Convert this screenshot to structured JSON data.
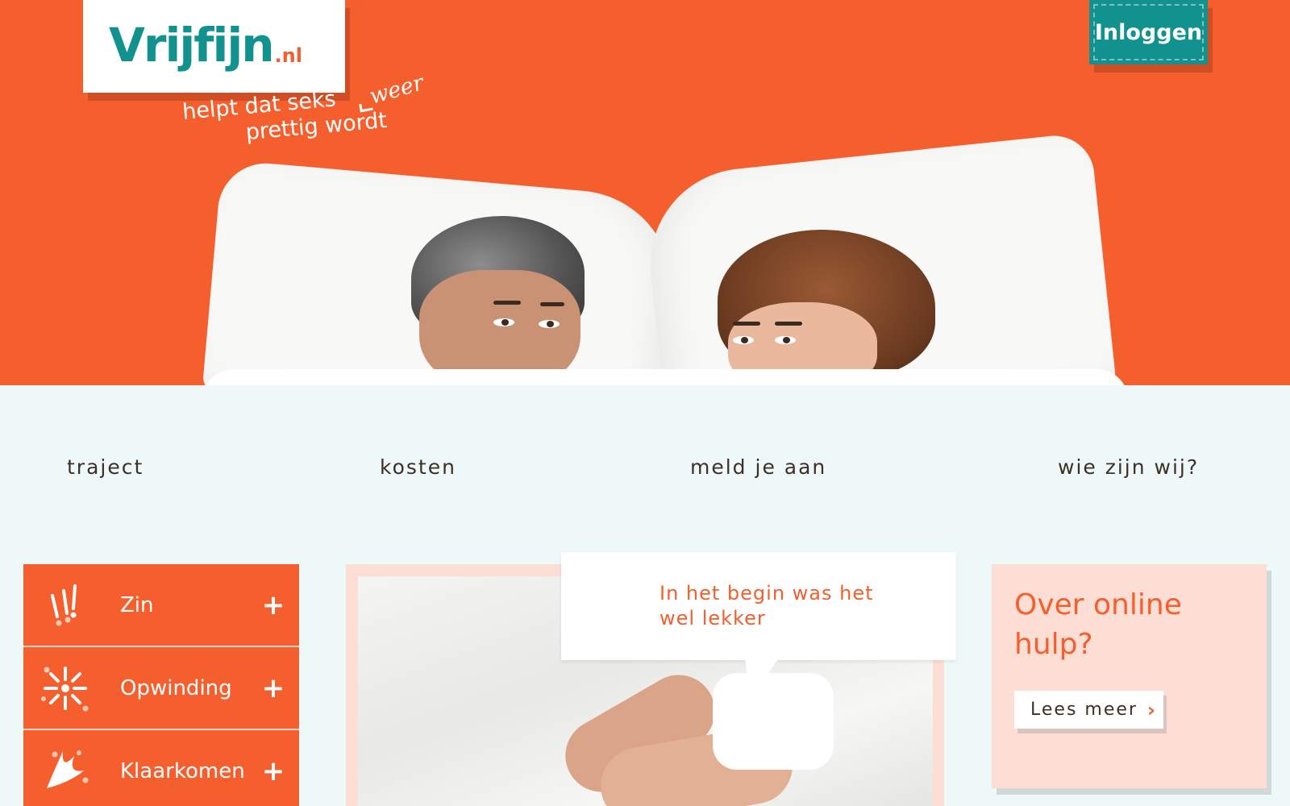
{
  "brand": {
    "name": "Vrijfijn",
    "tld": ".nl",
    "tagline_line1": "helpt dat seks",
    "tagline_line2": "prettig wordt",
    "tagline_insert": "weer",
    "colors": {
      "primary": "#f45f2d",
      "teal": "#12928e",
      "page_bg": "#eef8f8",
      "card_bg": "#fcded4"
    }
  },
  "header": {
    "login_label": "Inloggen"
  },
  "nav": {
    "items": [
      {
        "label": "traject"
      },
      {
        "label": "kosten"
      },
      {
        "label": "meld je aan"
      },
      {
        "label": "wie zijn wij?"
      }
    ]
  },
  "sidebar": {
    "items": [
      {
        "label": "Zin",
        "icon": "exclamation-icon"
      },
      {
        "label": "Opwinding",
        "icon": "sparkle-icon"
      },
      {
        "label": "Klaarkomen",
        "icon": "burst-icon"
      }
    ],
    "expand_symbol": "+"
  },
  "story": {
    "quote": "In het begin was het wel lekker"
  },
  "help": {
    "title": "Over online hulp?",
    "button_label": "Lees meer",
    "button_icon": "chevron-right-icon"
  }
}
